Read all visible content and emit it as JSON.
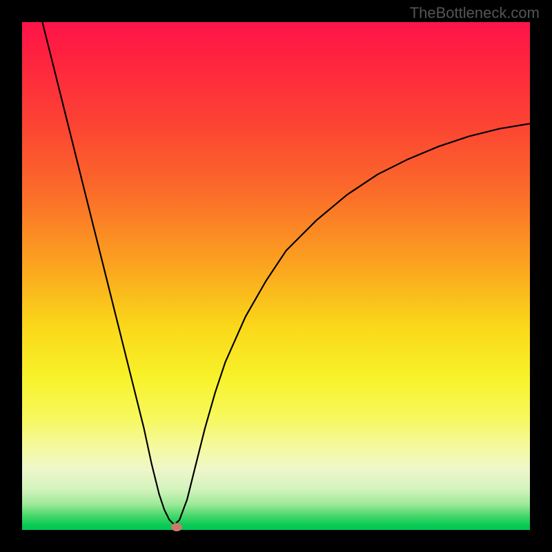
{
  "watermark": "TheBottleneck.com",
  "chart_data": {
    "type": "line",
    "title": "",
    "xlabel": "",
    "ylabel": "",
    "xlim": [
      0,
      100
    ],
    "ylim": [
      0,
      100
    ],
    "series": [
      {
        "name": "bottleneck-curve",
        "x": [
          4,
          6,
          8,
          10,
          12,
          14,
          16,
          18,
          20,
          22,
          24,
          25.5,
          27,
          28,
          29,
          30,
          31,
          32.5,
          34,
          36,
          38,
          40,
          44,
          48,
          52,
          58,
          64,
          70,
          76,
          82,
          88,
          94,
          100
        ],
        "y": [
          100,
          92,
          84,
          76,
          68,
          60,
          52,
          44,
          36,
          28,
          20,
          13,
          7,
          4,
          2,
          1,
          2,
          6,
          12,
          20,
          27,
          33,
          42,
          49,
          55,
          61,
          66,
          70,
          73,
          75.5,
          77.5,
          79,
          80
        ]
      }
    ],
    "markers": [
      {
        "name": "optimal-point",
        "x": 30.5,
        "y": 0.5
      }
    ],
    "gradient_meaning": "green=low bottleneck, red=high bottleneck"
  }
}
